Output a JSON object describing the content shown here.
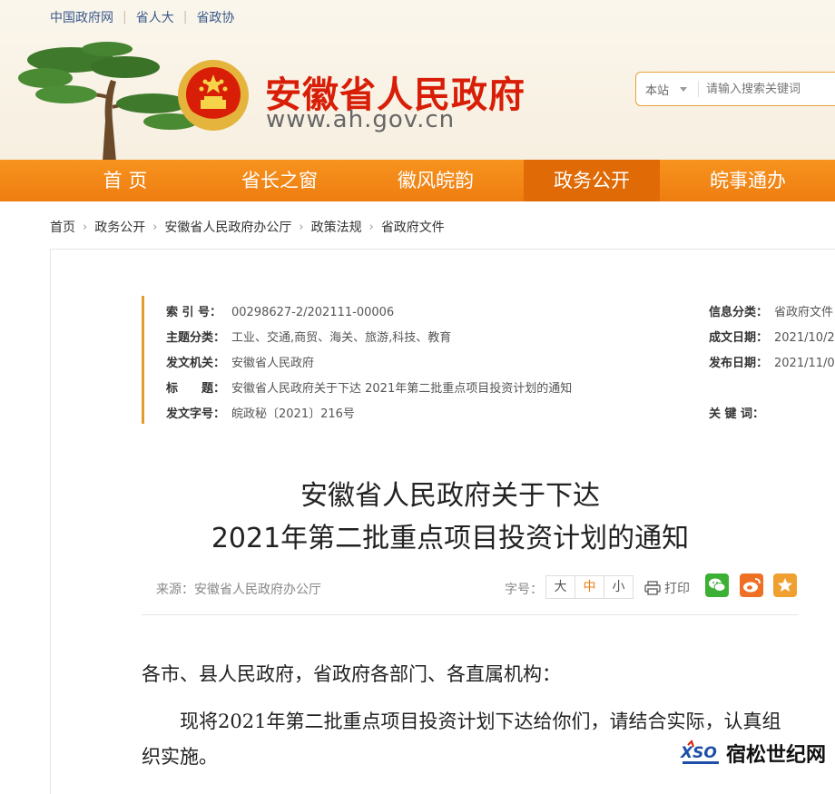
{
  "top_links": [
    "中国政府网",
    "省人大",
    "省政协"
  ],
  "site": {
    "title": "安徽省人民政府",
    "url": "www.ah.gov.cn"
  },
  "search": {
    "scope": "本站",
    "placeholder": "请输入搜索关键词"
  },
  "nav": {
    "items": [
      "首 页",
      "省长之窗",
      "徽风皖韵",
      "政务公开",
      "皖事通办"
    ],
    "active_index": 3
  },
  "breadcrumb": [
    "首页",
    "政务公开",
    "安徽省人民政府办公厅",
    "政策法规",
    "省政府文件"
  ],
  "meta": {
    "index_label": "索 引 号：",
    "index_value": "00298627-2/202111-00006",
    "topic_label": "主题分类：",
    "topic_value": "工业、交通,商贸、海关、旅游,科技、教育",
    "issuer_label": "发文机关：",
    "issuer_value": "安徽省人民政府",
    "title_label": "标　　题：",
    "title_value": "安徽省人民政府关于下达 2021年第二批重点项目投资计划的通知",
    "docno_label": "发文字号：",
    "docno_value": "皖政秘〔2021〕216号",
    "category_label": "信息分类：",
    "category_value": "省政府文件",
    "created_label": "成文日期：",
    "created_value": "2021/10/2",
    "published_label": "发布日期：",
    "published_value": "2021/11/0",
    "keywords_label": "关 键 词：",
    "keywords_value": ""
  },
  "article": {
    "title_line1": "安徽省人民政府关于下达",
    "title_line2": "2021年第二批重点项目投资计划的通知",
    "source": "来源：安徽省人民政府办公厅",
    "font_label": "字号：",
    "font_sizes": [
      "大",
      "中",
      "小"
    ],
    "font_active": 1,
    "print_label": "打印",
    "salutation": "各市、县人民政府，省政府各部门、各直属机构：",
    "body_line1": "现将2021年第二批重点项目投资计划下达给你们，请结合实际，认真组",
    "body_line2": "织实施。"
  },
  "watermark": {
    "logo_text": "XSO",
    "text": "宿松世纪网"
  },
  "colors": {
    "brand_red": "#d81e06",
    "nav_orange": "#f7931e",
    "nav_active": "#e06a05",
    "accent_border": "#e59a2c",
    "wechat_green": "#3cb034",
    "weibo_orange": "#ef6f24",
    "favorite_orange": "#f0a030"
  },
  "icons": [
    "national-emblem-icon",
    "pine-tree-icon",
    "print-icon",
    "wechat-icon",
    "weibo-icon",
    "favorite-star-icon"
  ]
}
